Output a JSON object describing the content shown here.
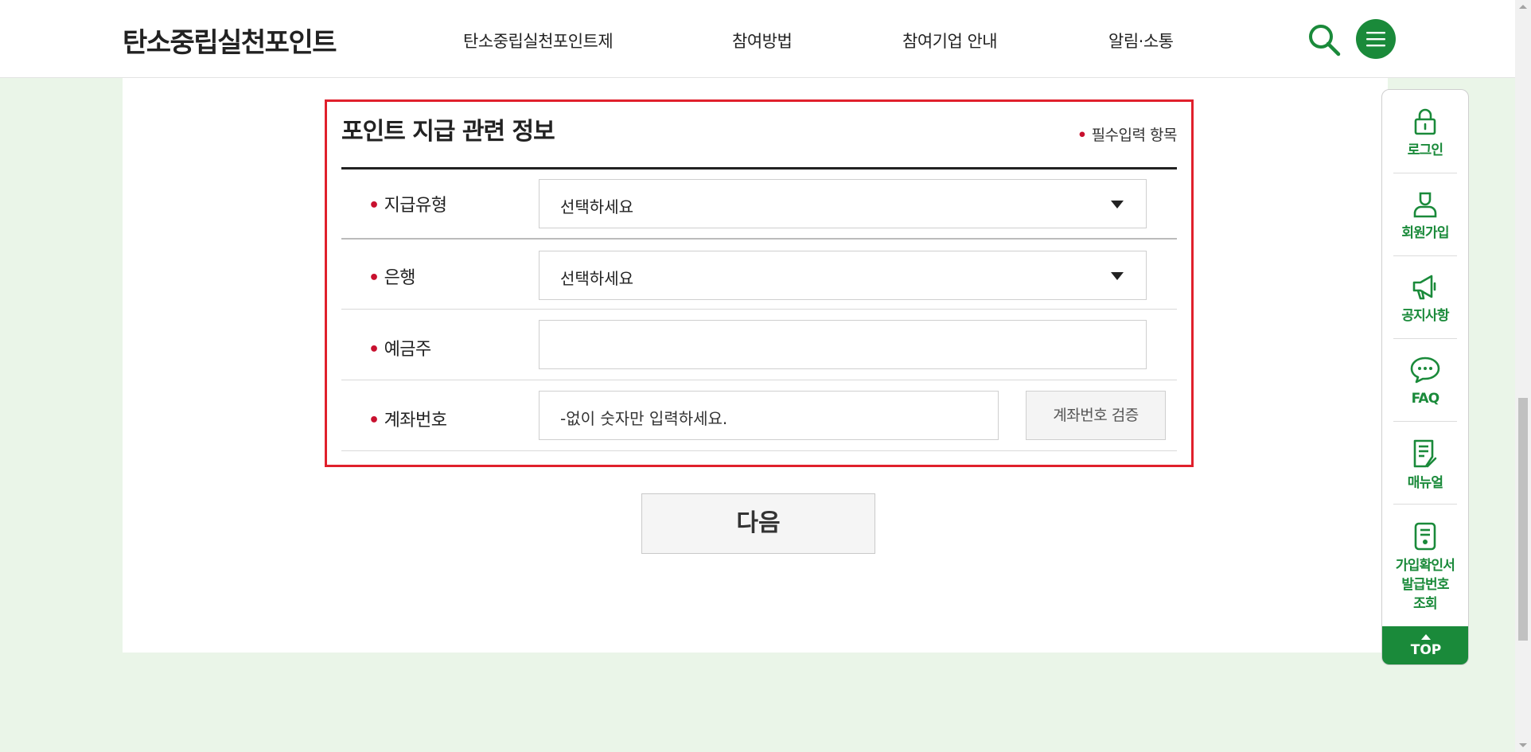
{
  "header": {
    "logo": "탄소중립실천포인트",
    "nav": [
      {
        "label": "탄소중립실천포인트제"
      },
      {
        "label": "참여방법"
      },
      {
        "label": "참여기업 안내"
      },
      {
        "label": "알림·소통"
      }
    ]
  },
  "form": {
    "title": "포인트 지급 관련 정보",
    "required_note": "필수입력 항목",
    "rows": [
      {
        "label": "지급유형",
        "value": "선택하세요"
      },
      {
        "label": "은행",
        "value": "선택하세요"
      },
      {
        "label": "예금주",
        "value": ""
      },
      {
        "label": "계좌번호",
        "placeholder": "-없이 숫자만 입력하세요.",
        "button": "계좌번호 검증"
      }
    ]
  },
  "next_button": "다음",
  "quick_menu": {
    "items": [
      {
        "label": "로그인",
        "icon": "lock-icon"
      },
      {
        "label": "회원가입",
        "icon": "user-icon"
      },
      {
        "label": "공지사항",
        "icon": "megaphone-icon"
      },
      {
        "label": "FAQ",
        "icon": "chat-icon"
      },
      {
        "label": "매뉴얼",
        "icon": "manual-icon"
      },
      {
        "label_lines": [
          "가입확인서",
          "발급번호",
          "조회"
        ],
        "icon": "certificate-icon"
      }
    ],
    "top_label": "TOP"
  },
  "colors": {
    "brand_green": "#1a8a3a",
    "highlight_red": "#e0202c",
    "required_dot": "#c8102e",
    "page_bg": "#eaf5e8"
  }
}
